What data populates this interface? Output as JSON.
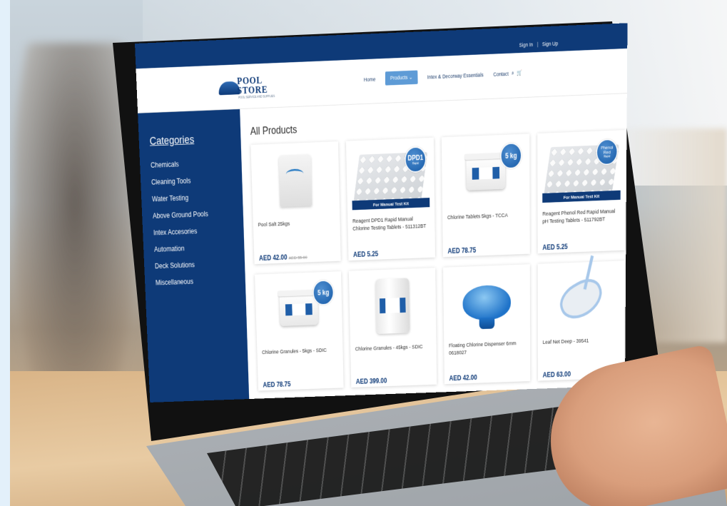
{
  "topbar": {
    "sign_in": "Sign In",
    "separator": "|",
    "sign_up": "Sign Up"
  },
  "logo": {
    "line1": "POOL",
    "line2": "STORE",
    "tagline": "POOL SERVICE AND SUPPLIES"
  },
  "nav": {
    "home": "Home",
    "products": "Products",
    "intex": "Intex & Decorway Essentials",
    "contact": "Contact"
  },
  "sidebar": {
    "title": "Categories",
    "items": [
      "Chemicals",
      "Cleaning Tools",
      "Water Testing",
      "Above Ground Pools",
      "Intex Accesories",
      "Automation",
      "Deck Solutions",
      "Miscellaneous"
    ]
  },
  "main": {
    "title": "All Products"
  },
  "products": [
    {
      "name": "Pool Salt 25kgs",
      "price": "AED 42.00",
      "old_price": "AED 55.00"
    },
    {
      "name": "Reagent DPD1 Rapid Manual Chlorine Testing Tablets - 511312BT",
      "price": "AED 5.25",
      "badge_top": "DPD1",
      "badge_bottom": "Rapid",
      "strip": "For Manual Test Kit"
    },
    {
      "name": "Chlorine Tablets 5kgs - TCCA",
      "price": "AED 78.75",
      "badge": "5 kg"
    },
    {
      "name": "Reagent Phenol Red Rapid Manual pH Testing Tablets - 511792BT",
      "price": "AED 5.25",
      "badge_top": "Phenol",
      "badge_mid": "Red",
      "badge_bottom": "Rapid",
      "strip": "For Manual Test Kit"
    },
    {
      "name": "Chlorine Granules - 5kgs - SDIC",
      "price": "AED 78.75",
      "badge": "5 kg"
    },
    {
      "name": "Chlorine Granules - 45kgs - SDIC",
      "price": "AED 399.00"
    },
    {
      "name": "Floating Chlorine Dispenser 6mm 0618027",
      "price": "AED 42.00"
    },
    {
      "name": "Leaf Net Deep - 39541",
      "price": "AED 63.00"
    }
  ],
  "colors": {
    "brand": "#0e3a78",
    "accent": "#5e9bd6"
  },
  "icons": [
    "search-icon",
    "cart-icon",
    "chevron-down-icon"
  ]
}
